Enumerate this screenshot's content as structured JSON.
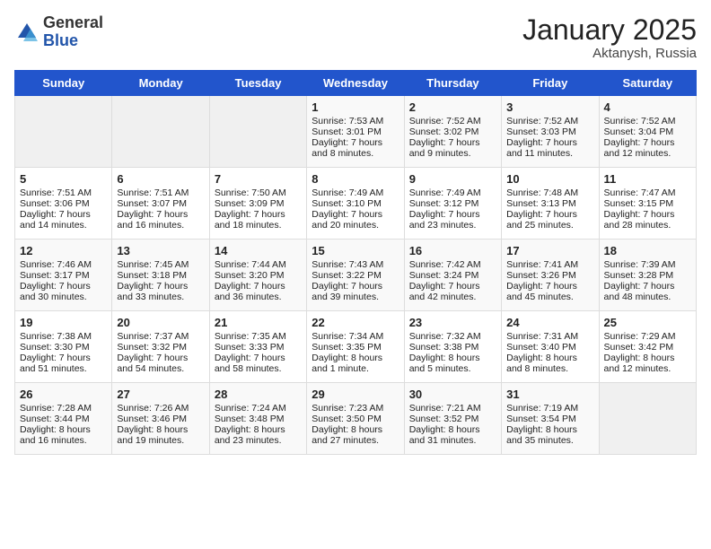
{
  "header": {
    "logo_general": "General",
    "logo_blue": "Blue",
    "title": "January 2025",
    "subtitle": "Aktanysh, Russia"
  },
  "weekdays": [
    "Sunday",
    "Monday",
    "Tuesday",
    "Wednesday",
    "Thursday",
    "Friday",
    "Saturday"
  ],
  "weeks": [
    [
      {
        "day": "",
        "text": ""
      },
      {
        "day": "",
        "text": ""
      },
      {
        "day": "",
        "text": ""
      },
      {
        "day": "1",
        "text": "Sunrise: 7:53 AM\nSunset: 3:01 PM\nDaylight: 7 hours and 8 minutes."
      },
      {
        "day": "2",
        "text": "Sunrise: 7:52 AM\nSunset: 3:02 PM\nDaylight: 7 hours and 9 minutes."
      },
      {
        "day": "3",
        "text": "Sunrise: 7:52 AM\nSunset: 3:03 PM\nDaylight: 7 hours and 11 minutes."
      },
      {
        "day": "4",
        "text": "Sunrise: 7:52 AM\nSunset: 3:04 PM\nDaylight: 7 hours and 12 minutes."
      }
    ],
    [
      {
        "day": "5",
        "text": "Sunrise: 7:51 AM\nSunset: 3:06 PM\nDaylight: 7 hours and 14 minutes."
      },
      {
        "day": "6",
        "text": "Sunrise: 7:51 AM\nSunset: 3:07 PM\nDaylight: 7 hours and 16 minutes."
      },
      {
        "day": "7",
        "text": "Sunrise: 7:50 AM\nSunset: 3:09 PM\nDaylight: 7 hours and 18 minutes."
      },
      {
        "day": "8",
        "text": "Sunrise: 7:49 AM\nSunset: 3:10 PM\nDaylight: 7 hours and 20 minutes."
      },
      {
        "day": "9",
        "text": "Sunrise: 7:49 AM\nSunset: 3:12 PM\nDaylight: 7 hours and 23 minutes."
      },
      {
        "day": "10",
        "text": "Sunrise: 7:48 AM\nSunset: 3:13 PM\nDaylight: 7 hours and 25 minutes."
      },
      {
        "day": "11",
        "text": "Sunrise: 7:47 AM\nSunset: 3:15 PM\nDaylight: 7 hours and 28 minutes."
      }
    ],
    [
      {
        "day": "12",
        "text": "Sunrise: 7:46 AM\nSunset: 3:17 PM\nDaylight: 7 hours and 30 minutes."
      },
      {
        "day": "13",
        "text": "Sunrise: 7:45 AM\nSunset: 3:18 PM\nDaylight: 7 hours and 33 minutes."
      },
      {
        "day": "14",
        "text": "Sunrise: 7:44 AM\nSunset: 3:20 PM\nDaylight: 7 hours and 36 minutes."
      },
      {
        "day": "15",
        "text": "Sunrise: 7:43 AM\nSunset: 3:22 PM\nDaylight: 7 hours and 39 minutes."
      },
      {
        "day": "16",
        "text": "Sunrise: 7:42 AM\nSunset: 3:24 PM\nDaylight: 7 hours and 42 minutes."
      },
      {
        "day": "17",
        "text": "Sunrise: 7:41 AM\nSunset: 3:26 PM\nDaylight: 7 hours and 45 minutes."
      },
      {
        "day": "18",
        "text": "Sunrise: 7:39 AM\nSunset: 3:28 PM\nDaylight: 7 hours and 48 minutes."
      }
    ],
    [
      {
        "day": "19",
        "text": "Sunrise: 7:38 AM\nSunset: 3:30 PM\nDaylight: 7 hours and 51 minutes."
      },
      {
        "day": "20",
        "text": "Sunrise: 7:37 AM\nSunset: 3:32 PM\nDaylight: 7 hours and 54 minutes."
      },
      {
        "day": "21",
        "text": "Sunrise: 7:35 AM\nSunset: 3:33 PM\nDaylight: 7 hours and 58 minutes."
      },
      {
        "day": "22",
        "text": "Sunrise: 7:34 AM\nSunset: 3:35 PM\nDaylight: 8 hours and 1 minute."
      },
      {
        "day": "23",
        "text": "Sunrise: 7:32 AM\nSunset: 3:38 PM\nDaylight: 8 hours and 5 minutes."
      },
      {
        "day": "24",
        "text": "Sunrise: 7:31 AM\nSunset: 3:40 PM\nDaylight: 8 hours and 8 minutes."
      },
      {
        "day": "25",
        "text": "Sunrise: 7:29 AM\nSunset: 3:42 PM\nDaylight: 8 hours and 12 minutes."
      }
    ],
    [
      {
        "day": "26",
        "text": "Sunrise: 7:28 AM\nSunset: 3:44 PM\nDaylight: 8 hours and 16 minutes."
      },
      {
        "day": "27",
        "text": "Sunrise: 7:26 AM\nSunset: 3:46 PM\nDaylight: 8 hours and 19 minutes."
      },
      {
        "day": "28",
        "text": "Sunrise: 7:24 AM\nSunset: 3:48 PM\nDaylight: 8 hours and 23 minutes."
      },
      {
        "day": "29",
        "text": "Sunrise: 7:23 AM\nSunset: 3:50 PM\nDaylight: 8 hours and 27 minutes."
      },
      {
        "day": "30",
        "text": "Sunrise: 7:21 AM\nSunset: 3:52 PM\nDaylight: 8 hours and 31 minutes."
      },
      {
        "day": "31",
        "text": "Sunrise: 7:19 AM\nSunset: 3:54 PM\nDaylight: 8 hours and 35 minutes."
      },
      {
        "day": "",
        "text": ""
      }
    ]
  ]
}
